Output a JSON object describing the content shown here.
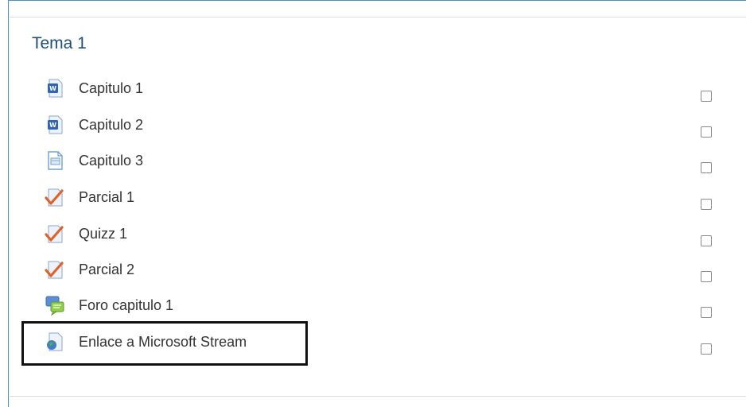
{
  "section": {
    "title": "Tema 1"
  },
  "activities": [
    {
      "label": "Capitulo 1",
      "icon": "word-document-icon"
    },
    {
      "label": "Capitulo 2",
      "icon": "word-document-icon"
    },
    {
      "label": "Capitulo 3",
      "icon": "page-icon"
    },
    {
      "label": "Parcial 1",
      "icon": "quiz-icon"
    },
    {
      "label": "Quizz 1",
      "icon": "quiz-icon"
    },
    {
      "label": "Parcial 2",
      "icon": "quiz-icon"
    },
    {
      "label": "Foro capitulo 1",
      "icon": "forum-icon"
    },
    {
      "label": "Enlace a Microsoft Stream",
      "icon": "url-link-icon"
    }
  ],
  "colors": {
    "title": "#1d4f7a",
    "frame_border": "#4a90c8",
    "quiz_check": "#e0622a"
  }
}
